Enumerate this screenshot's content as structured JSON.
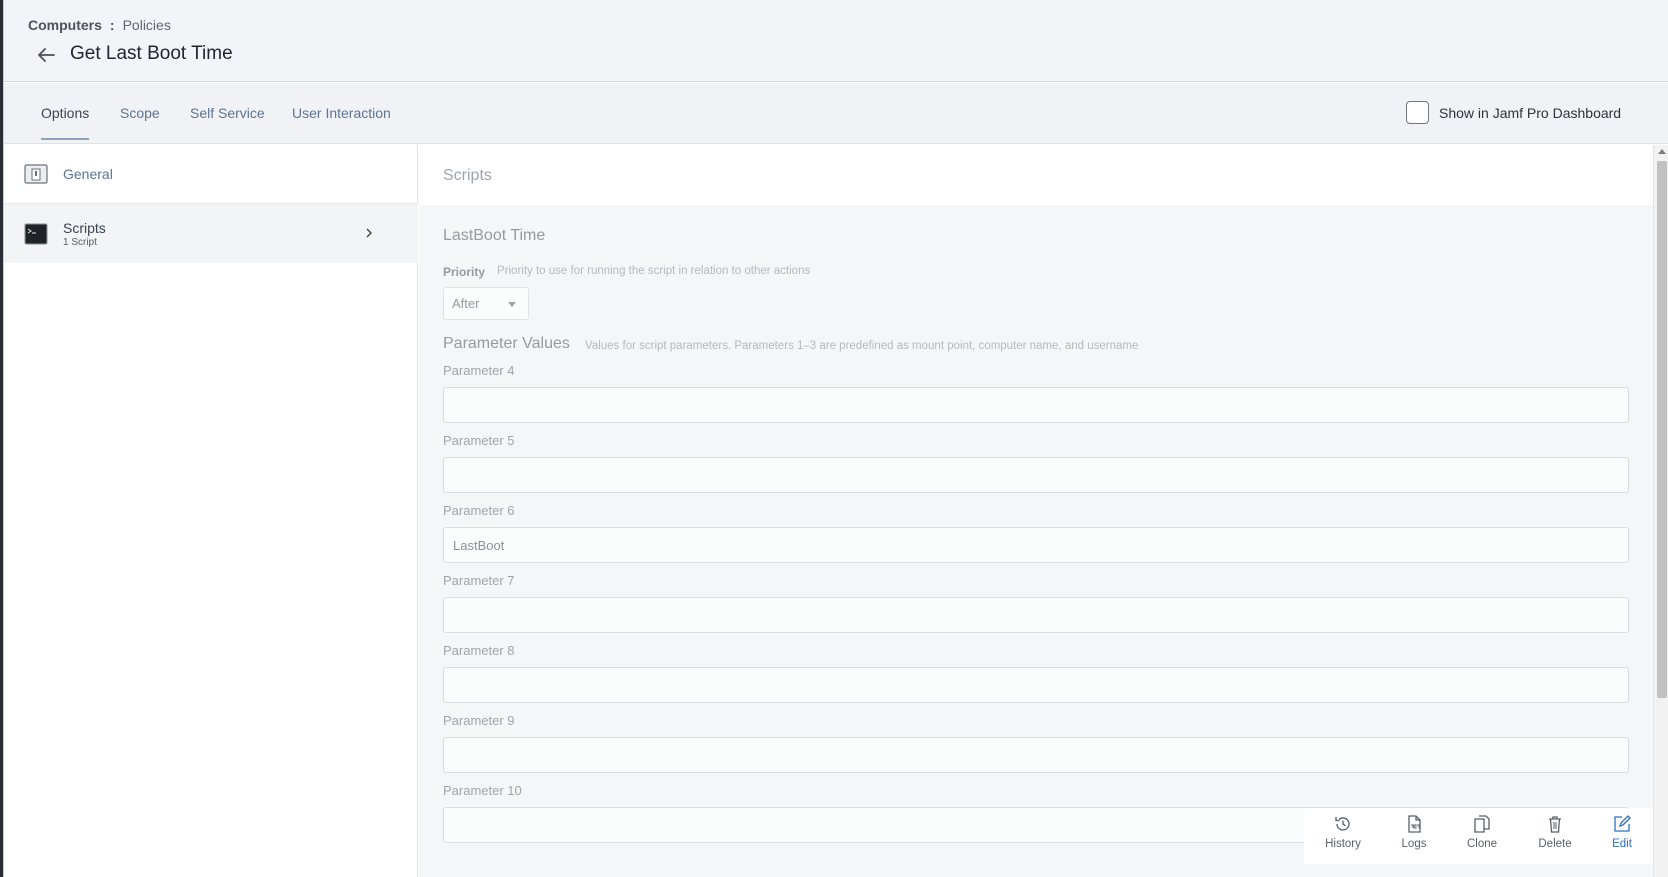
{
  "breadcrumb": {
    "root": "Computers",
    "separator": ":",
    "leaf": "Policies"
  },
  "page": {
    "title": "Get Last Boot Time"
  },
  "tabs": [
    {
      "label": "Options",
      "active": true
    },
    {
      "label": "Scope",
      "active": false
    },
    {
      "label": "Self Service",
      "active": false
    },
    {
      "label": "User Interaction",
      "active": false
    }
  ],
  "dashboard": {
    "label": "Show in Jamf Pro Dashboard",
    "checked": false
  },
  "sidebar": {
    "items": [
      {
        "label": "General",
        "sublabel": ""
      },
      {
        "label": "Scripts",
        "sublabel": "1 Script"
      }
    ]
  },
  "main": {
    "title": "Scripts",
    "script_name": "LastBoot Time",
    "priority": {
      "label": "Priority",
      "description": "Priority to use for running the script in relation to other actions",
      "value": "After"
    },
    "parameter_values": {
      "title": "Parameter Values",
      "description": "Values for script parameters. Parameters 1–3 are predefined as mount point, computer name, and username"
    },
    "parameters": [
      {
        "label": "Parameter 4",
        "value": ""
      },
      {
        "label": "Parameter 5",
        "value": ""
      },
      {
        "label": "Parameter 6",
        "value": "LastBoot"
      },
      {
        "label": "Parameter 7",
        "value": ""
      },
      {
        "label": "Parameter 8",
        "value": ""
      },
      {
        "label": "Parameter 9",
        "value": ""
      },
      {
        "label": "Parameter 10",
        "value": ""
      }
    ]
  },
  "actions": [
    {
      "label": "History",
      "icon": "history-icon"
    },
    {
      "label": "Logs",
      "icon": "logs-icon"
    },
    {
      "label": "Clone",
      "icon": "clone-icon"
    },
    {
      "label": "Delete",
      "icon": "trash-icon"
    },
    {
      "label": "Edit",
      "icon": "edit-icon"
    }
  ],
  "colors": {
    "accent": "#2f6fbd",
    "tab_text": "#5b7494",
    "header_bg": "#f3f4f7"
  }
}
